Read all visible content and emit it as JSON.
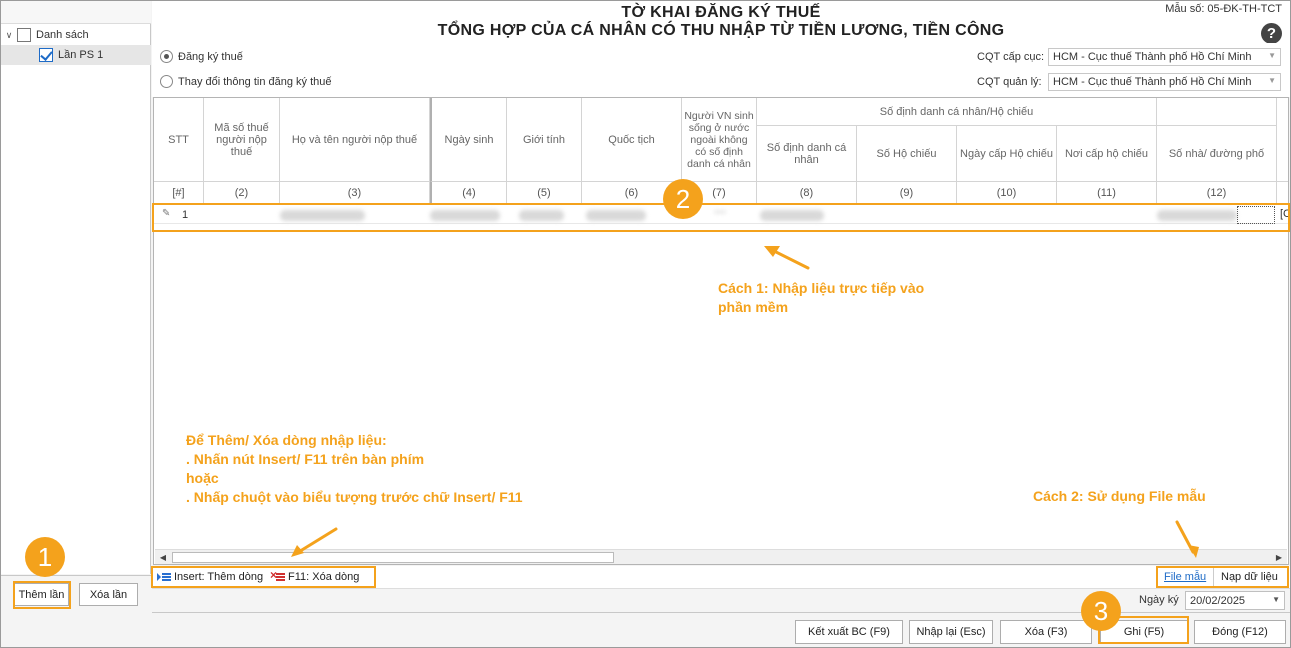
{
  "tree": {
    "root_label": "Danh sách",
    "child_label": "Lần PS 1"
  },
  "left_buttons": {
    "add": "Thêm lần",
    "delete": "Xóa lần"
  },
  "header": {
    "title_line1": "TỜ KHAI ĐĂNG KÝ THUẾ",
    "title_line2": "TỔNG HỢP CỦA CÁ NHÂN CÓ THU NHẬP TỪ TIỀN LƯƠNG, TIỀN CÔNG",
    "form_code": "Mẫu số: 05-ĐK-TH-TCT",
    "help": "?"
  },
  "options": {
    "radio1": "Đăng ký thuế",
    "radio2": "Thay đổi thông tin đăng ký thuế",
    "cqt_cap_cuc_label": "CQT cấp cục:",
    "cqt_cap_cuc_value": "HCM - Cục thuế Thành phố Hồ Chí Minh",
    "cqt_quan_ly_label": "CQT quản lý:",
    "cqt_quan_ly_value": "HCM - Cục thuế Thành phố Hồ Chí Minh"
  },
  "grid": {
    "columns": {
      "stt": "STT",
      "mst": "Mã số thuế người nộp thuế",
      "ho_ten": "Họ và tên người nộp thuế",
      "ngay_sinh": "Ngày sinh",
      "gioi_tinh": "Giới tính",
      "quoc_tich": "Quốc tịch",
      "nguoi_vn": "Người VN sinh sống ở nước ngoài không có số định danh cá nhân",
      "group_dinh_danh": "Số định danh cá nhân/Hộ chiếu",
      "so_dinh_danh": "Số định danh cá nhân",
      "so_ho_chieu": "Số Hộ chiếu",
      "ngay_cap": "Ngày cấp Hộ chiếu",
      "noi_cap": "Nơi cấp hộ chiếu",
      "so_nha": "Số nhà/ đường phố"
    },
    "numbers": [
      "[#]",
      "(2)",
      "(3)",
      "(4)",
      "(5)",
      "(6)",
      "(7)",
      "(8)",
      "(9)",
      "(10)",
      "(11)",
      "(12)"
    ],
    "row": {
      "stt": "1",
      "edge": "[C"
    }
  },
  "grid_footer": {
    "insert": "Insert: Thêm dòng",
    "f11": "F11: Xóa dòng",
    "file_mau": "File mẫu",
    "nap_du_lieu": "Nạp dữ liệu"
  },
  "date": {
    "label": "Ngày ký",
    "value": "20/02/2025"
  },
  "bottom_buttons": {
    "ket_xuat": "Kết xuất BC (F9)",
    "nhap_lai": "Nhập lại (Esc)",
    "xoa": "Xóa (F3)",
    "ghi": "Ghi (F5)",
    "dong": "Đóng (F12)"
  },
  "annotations": {
    "badge1": "1",
    "badge2": "2",
    "badge3": "3",
    "cach1_line1": "Cách 1: Nhập liệu trực tiếp vào",
    "cach1_line2": "phần mềm",
    "cach2": "Cách 2: Sử dụng File mẫu",
    "howto_line1": "Để Thêm/ Xóa dòng nhập liệu:",
    "howto_line2": ". Nhấn nút Insert/ F11 trên bàn phím",
    "howto_line3": "hoặc",
    "howto_line4": ". Nhấp chuột vào biểu tượng trước chữ Insert/ F11",
    "color": "#f4a21c"
  }
}
